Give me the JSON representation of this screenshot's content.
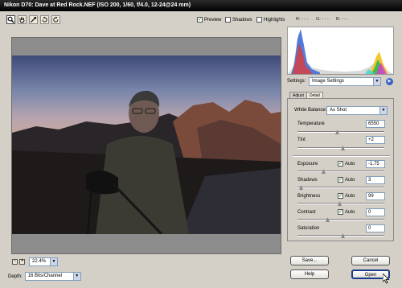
{
  "window": {
    "title": "Nikon D70:  Dave at Red Rock.NEF  (ISO 200, 1/60, f/4.0, 12-24@24 mm)"
  },
  "toolbar": {
    "tools": [
      "zoom-icon",
      "hand-icon",
      "eyedropper-icon",
      "rotate-left-icon",
      "rotate-right-icon"
    ],
    "preview_label": "Preview",
    "shadows_label": "Shadows",
    "highlights_label": "Highlights",
    "rgb": {
      "r": "R: - - -",
      "g": "G: - - -",
      "b": "B: - - -"
    }
  },
  "zoom": {
    "value": "22.4%"
  },
  "depth": {
    "label": "Depth:",
    "value": "16 Bits/Channel"
  },
  "settings": {
    "label": "Settings:",
    "value": "Image Settings"
  },
  "tabs": [
    {
      "label": "Adjust"
    },
    {
      "label": "Detail"
    }
  ],
  "adjust": {
    "white_balance_label": "White Balance:",
    "white_balance_value": "As Shot",
    "temperature": {
      "label": "Temperature",
      "value": "6550"
    },
    "tint": {
      "label": "Tint",
      "value": "+2"
    },
    "exposure": {
      "label": "Exposure",
      "auto_label": "Auto",
      "value": "-1.75"
    },
    "shadows": {
      "label": "Shadows",
      "auto_label": "Auto",
      "value": "3"
    },
    "brightness": {
      "label": "Brightness",
      "auto_label": "Auto",
      "value": "99"
    },
    "contrast": {
      "label": "Contrast",
      "auto_label": "Auto",
      "value": "0"
    },
    "saturation": {
      "label": "Saturation",
      "value": "0"
    }
  },
  "buttons": {
    "save": "Save...",
    "cancel": "Cancel",
    "help": "Help",
    "open": "Open"
  },
  "colors": {
    "titlebar": "#000000",
    "primary_border": "#1c3a8a",
    "window_bg": "#d4d0c8"
  }
}
